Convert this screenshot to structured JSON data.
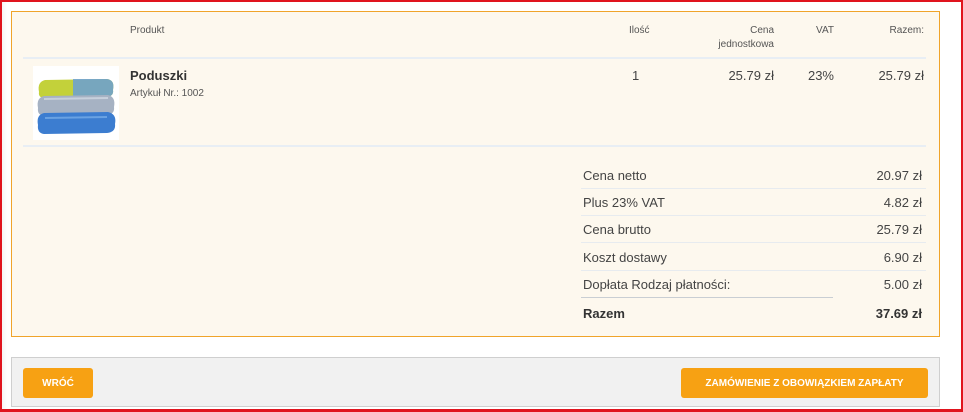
{
  "table": {
    "headers": {
      "product": "Produkt",
      "quantity": "Ilość",
      "unit_price": "Cena jednostkowa",
      "vat": "VAT",
      "total": "Razem:"
    },
    "items": [
      {
        "name": "Poduszki",
        "sku": "Artykuł Nr.: 1002",
        "quantity": "1",
        "unit_price": "25.79 zł",
        "vat": "23%",
        "total": "25.79 zł",
        "image_icon": "pillows-product-image"
      }
    ]
  },
  "summary": {
    "rows": [
      {
        "label": "Cena netto",
        "value": "20.97 zł"
      },
      {
        "label": "Plus 23% VAT",
        "value": "4.82 zł"
      },
      {
        "label": "Cena brutto",
        "value": "25.79 zł"
      },
      {
        "label": "Koszt dostawy",
        "value": "6.90 zł"
      },
      {
        "label": "Dopłata Rodzaj płatności:",
        "value": "5.00 zł"
      },
      {
        "label": "Razem",
        "value": "37.69 zł"
      }
    ]
  },
  "buttons": {
    "back": "Wróć",
    "order": "Zamówienie z obowiązkiem zapłaty"
  },
  "colors": {
    "accent": "#f7a113",
    "panel_border": "#f0a42a",
    "panel_bg": "#fdf8ee",
    "frame": "#e0141e"
  }
}
